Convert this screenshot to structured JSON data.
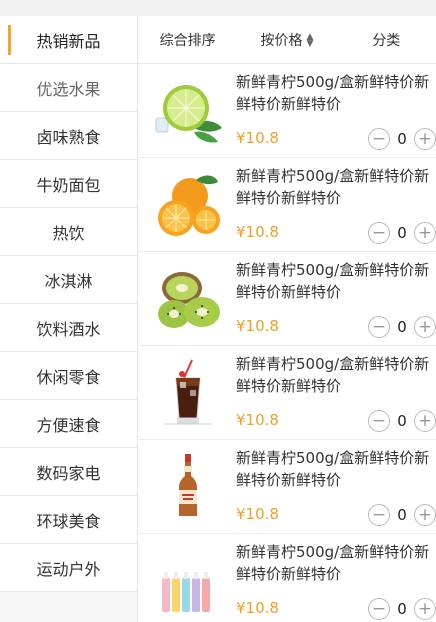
{
  "sidebar": {
    "items": [
      {
        "label": "热销新品"
      },
      {
        "label": "优选水果"
      },
      {
        "label": "卤味熟食"
      },
      {
        "label": "牛奶面包"
      },
      {
        "label": "热饮"
      },
      {
        "label": "冰淇淋"
      },
      {
        "label": "饮料酒水"
      },
      {
        "label": "休闲零食"
      },
      {
        "label": "方便速食"
      },
      {
        "label": "数码家电"
      },
      {
        "label": "环球美食"
      },
      {
        "label": "运动户外"
      }
    ]
  },
  "sortbar": {
    "default_label": "综合排序",
    "price_label": "按价格",
    "category_label": "分类"
  },
  "products": [
    {
      "name": "新鲜青柠500g/盒新鲜特价新鲜特价新鲜特价",
      "price": "¥10.8",
      "qty": "0",
      "icon": "lime-icon"
    },
    {
      "name": "新鲜青柠500g/盒新鲜特价新鲜特价新鲜特价",
      "price": "¥10.8",
      "qty": "0",
      "icon": "orange-icon"
    },
    {
      "name": "新鲜青柠500g/盒新鲜特价新鲜特价新鲜特价",
      "price": "¥10.8",
      "qty": "0",
      "icon": "kiwi-icon"
    },
    {
      "name": "新鲜青柠500g/盒新鲜特价新鲜特价新鲜特价",
      "price": "¥10.8",
      "qty": "0",
      "icon": "cola-glass-icon"
    },
    {
      "name": "新鲜青柠500g/盒新鲜特价新鲜特价新鲜特价",
      "price": "¥10.8",
      "qty": "0",
      "icon": "beer-bottle-icon"
    },
    {
      "name": "新鲜青柠500g/盒新鲜特价新鲜特价新鲜特价",
      "price": "¥10.8",
      "qty": "0",
      "icon": "drink-bottles-icon"
    }
  ],
  "stepper": {
    "minus": "−",
    "plus": "+"
  },
  "colors": {
    "accent": "#f5a623",
    "price": "#f0a024"
  }
}
